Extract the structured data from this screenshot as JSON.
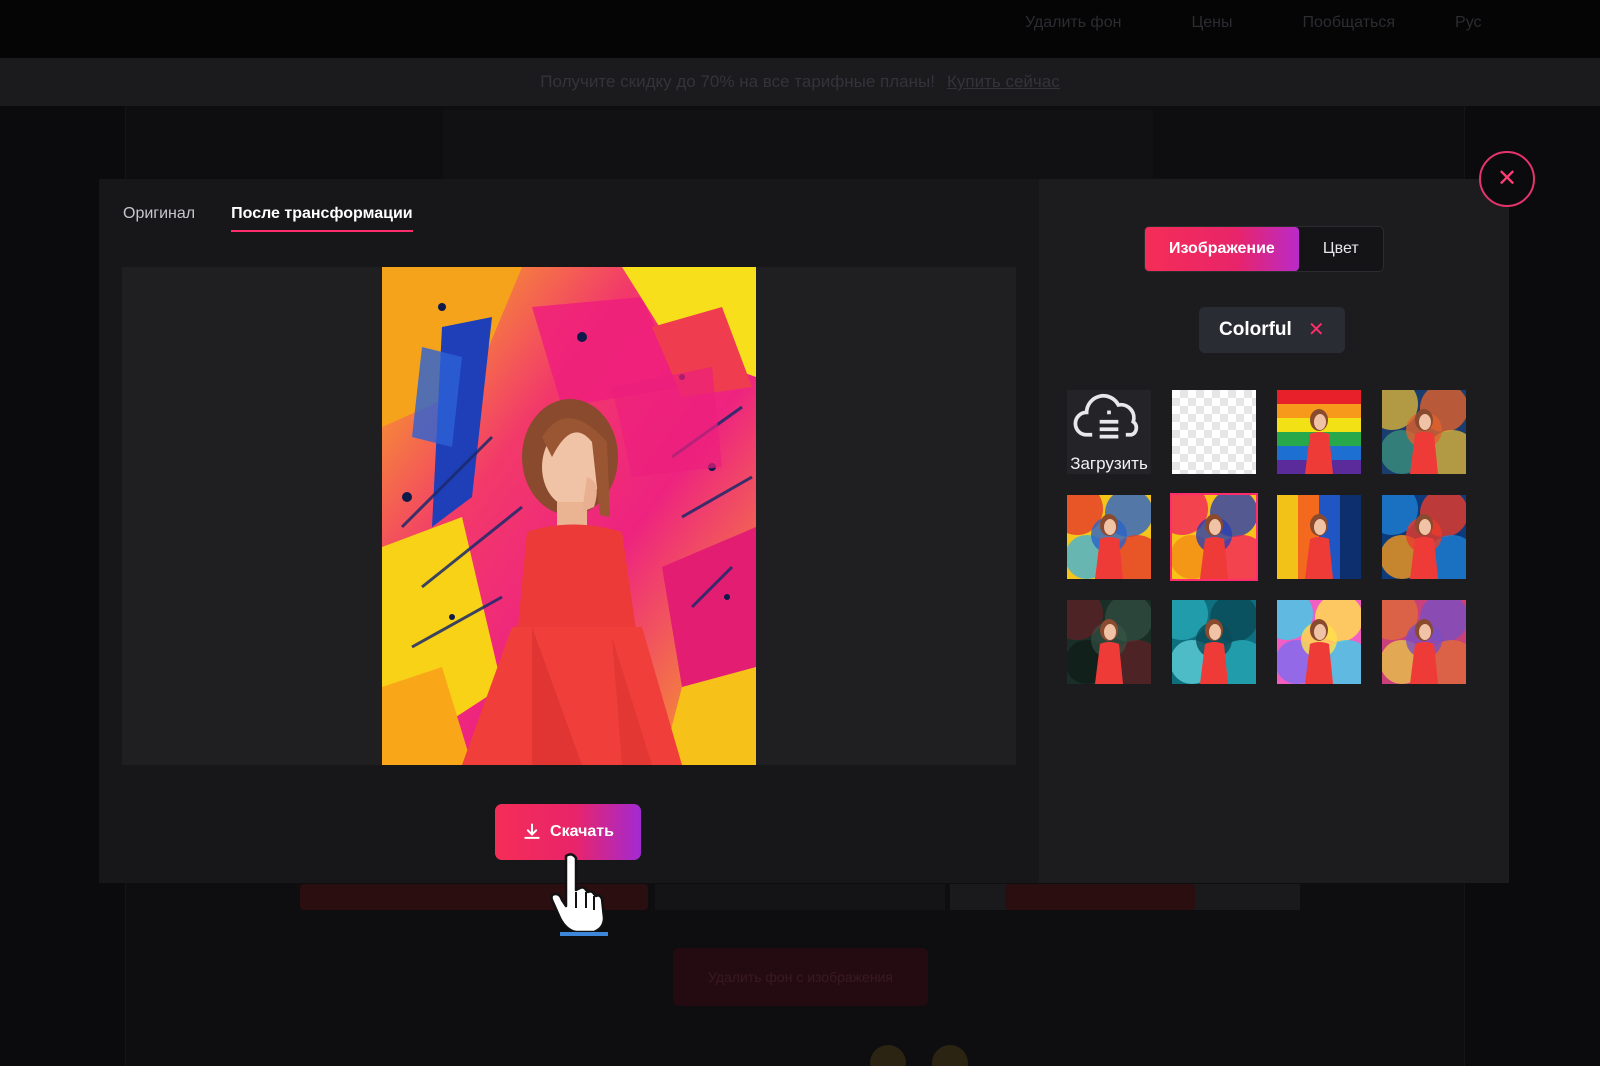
{
  "background": {
    "nav": [
      "Удалить фон",
      "Цены",
      "Пообщаться",
      "Рус"
    ],
    "promo_text": "Получите скидку до 70% на все тарифные планы!",
    "promo_link": "Купить сейчас",
    "cta_text": "Удалить фон с изображения"
  },
  "modal": {
    "close_icon": "close-icon",
    "tabs": [
      {
        "label": "Оригинал",
        "active": false
      },
      {
        "label": "После трансформации",
        "active": true
      }
    ],
    "download_button": {
      "label": "Скачать",
      "icon": "download-icon"
    },
    "right_panel": {
      "segments": [
        {
          "label": "Изображение",
          "active": true
        },
        {
          "label": "Цвет",
          "active": false
        }
      ],
      "filter_chip": {
        "label": "Colorful",
        "remove_icon": "close-icon"
      },
      "upload_label": "Загрузить",
      "upload_icon": "cloud-upload-icon",
      "thumbnails": [
        {
          "kind": "upload"
        },
        {
          "kind": "transparent"
        },
        {
          "kind": "image",
          "palette": [
            "#e8202a",
            "#f79a1c",
            "#f2e215",
            "#27a84a",
            "#1d6fd1",
            "#5b2b9c"
          ],
          "style": "rainbow"
        },
        {
          "kind": "image",
          "palette": [
            "#1a3d6e",
            "#d8b23a",
            "#e0612c",
            "#3a8f7a"
          ],
          "style": "mosaic"
        },
        {
          "kind": "image",
          "palette": [
            "#f4c51a",
            "#e5392a",
            "#2b63c9",
            "#43b2d8"
          ],
          "style": "paint"
        },
        {
          "kind": "image",
          "palette": [
            "#f7c317",
            "#f0235e",
            "#2a3fb0",
            "#f38b16"
          ],
          "style": "paint",
          "selected": true
        },
        {
          "kind": "image",
          "palette": [
            "#f2c218",
            "#f36a1e",
            "#1f56c4",
            "#0e2f6e"
          ],
          "style": "stripes"
        },
        {
          "kind": "image",
          "palette": [
            "#0d3a7a",
            "#1f7fd3",
            "#e93c2a",
            "#f59a1d"
          ],
          "style": "paint"
        },
        {
          "kind": "image",
          "palette": [
            "#1a2e28",
            "#7a1b22",
            "#3a5a4a",
            "#0d1512"
          ],
          "style": "dark"
        },
        {
          "kind": "image",
          "palette": [
            "#0e6f7f",
            "#27a7b7",
            "#0a4b57",
            "#5fd0d8"
          ],
          "style": "bokeh"
        },
        {
          "kind": "image",
          "palette": [
            "#f25ec2",
            "#3ad0e8",
            "#ffe14a",
            "#7b6cf0"
          ],
          "style": "bokeh"
        },
        {
          "kind": "image",
          "palette": [
            "#c9407a",
            "#e06a3a",
            "#7a4fc0",
            "#e8c24a"
          ],
          "style": "smoke"
        }
      ]
    }
  },
  "colors": {
    "accent": "#ff2d6b",
    "accent_gradient_end": "#a22ad2",
    "modal_left_bg": "#17171a",
    "modal_right_bg": "#1c1c1f"
  }
}
